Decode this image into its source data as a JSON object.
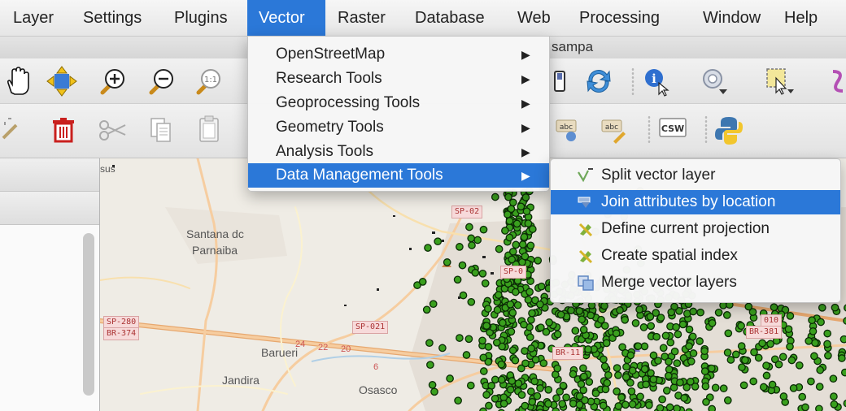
{
  "menubar": {
    "items": [
      "Layer",
      "Settings",
      "Plugins",
      "Vector",
      "Raster",
      "Database",
      "Web",
      "Processing",
      "Window",
      "Help"
    ],
    "active": "Vector"
  },
  "window": {
    "title_fragment": "sampa"
  },
  "vector_menu": {
    "items": [
      {
        "label": "OpenStreetMap",
        "has_submenu": true
      },
      {
        "label": "Research Tools",
        "has_submenu": true
      },
      {
        "label": "Geoprocessing Tools",
        "has_submenu": true
      },
      {
        "label": "Geometry Tools",
        "has_submenu": true
      },
      {
        "label": "Analysis Tools",
        "has_submenu": true
      },
      {
        "label": "Data Management Tools",
        "has_submenu": true,
        "highlighted": true
      }
    ]
  },
  "data_management_submenu": {
    "items": [
      {
        "label": "Split vector layer",
        "icon": "split-vector-icon"
      },
      {
        "label": "Join attributes by location",
        "icon": "join-attributes-icon",
        "highlighted": true
      },
      {
        "label": "Define current projection",
        "icon": "define-projection-icon"
      },
      {
        "label": "Create spatial index",
        "icon": "spatial-index-icon"
      },
      {
        "label": "Merge vector layers",
        "icon": "merge-layers-icon"
      }
    ]
  },
  "toolbar": {
    "csw_label": "CSW",
    "abc_label": "abc",
    "zoom_native_label": "1:1"
  },
  "map": {
    "place_labels": {
      "sus": "sus",
      "santana1": "Santana dc",
      "santana2": "Parnaiba",
      "barueri": "Barueri",
      "jandira": "Jandira",
      "osasco": "Osasco"
    },
    "shields": {
      "sp280": "SP-280",
      "br374": "BR-374",
      "sp021": "SP-021",
      "sp02": "SP-02",
      "sp0": "SP-0",
      "r010": "010",
      "br381": "BR-381",
      "br11": "BR-11",
      "n24": "24",
      "n22": "22",
      "n20": "20",
      "n6": "6"
    },
    "colors": {
      "points": "#3aa01e",
      "points_outline": "#0a2a05",
      "roads": "#f3c79a",
      "shield_bg": "#f7dada"
    }
  }
}
